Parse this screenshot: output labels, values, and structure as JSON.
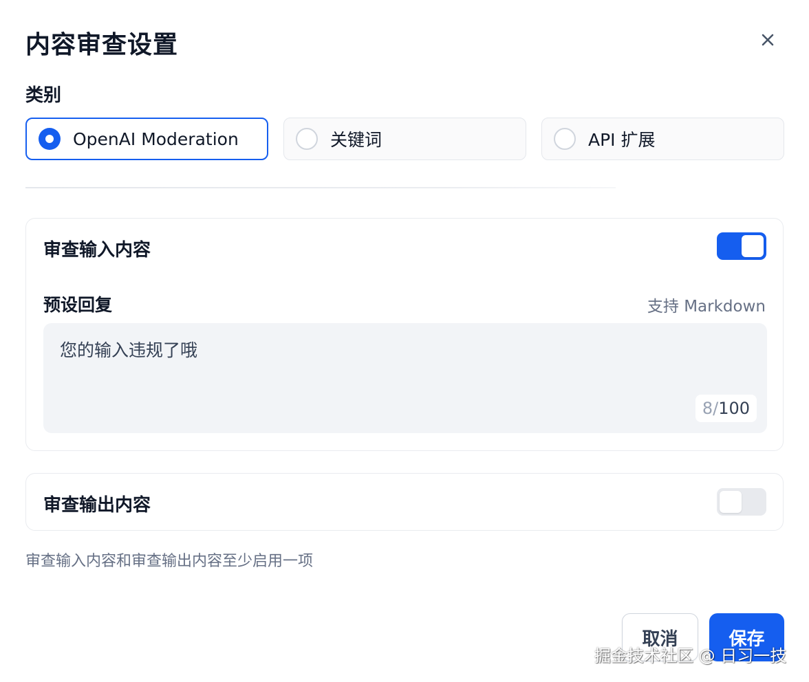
{
  "dialog": {
    "title": "内容审查设置",
    "close_icon": "close-icon"
  },
  "category": {
    "label": "类别",
    "options": [
      {
        "label": "OpenAI Moderation",
        "selected": true
      },
      {
        "label": "关键词",
        "selected": false
      },
      {
        "label": "API 扩展",
        "selected": false
      }
    ]
  },
  "input_review": {
    "title": "审查输入内容",
    "enabled": true,
    "preset_label": "预设回复",
    "markdown_note": "支持 Markdown",
    "preset_value": "您的输入违规了哦",
    "char_count": "8",
    "char_sep": "/",
    "char_max": "100"
  },
  "output_review": {
    "title": "审查输出内容",
    "enabled": false
  },
  "hint": "审查输入内容和审查输出内容至少启用一项",
  "footer": {
    "cancel_label": "取消",
    "save_label": "保存"
  },
  "watermark": "掘金技术社区 @ 日习一技",
  "colors": {
    "accent": "#155eef",
    "text_primary": "#101828",
    "text_secondary": "#667085"
  }
}
